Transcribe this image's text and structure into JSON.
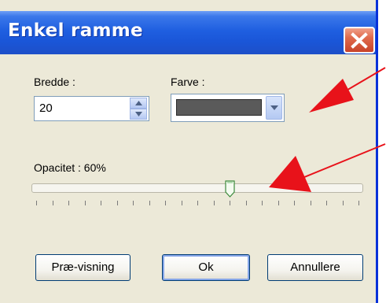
{
  "dialog": {
    "title": "Enkel ramme",
    "close_icon": "close-icon"
  },
  "width_field": {
    "label": "Bredde :",
    "value": "20",
    "up_icon": "spin-up-icon",
    "down_icon": "spin-down-icon"
  },
  "color_field": {
    "label": "Farve :",
    "swatch_color": "#5a5a5a",
    "dropdown_icon": "chevron-down-icon"
  },
  "opacity": {
    "label": "Opacitet : 60%",
    "level_fraction": 0.6,
    "tick_count": 21
  },
  "buttons": {
    "preview": "Præ-visning",
    "ok": "Ok",
    "cancel": "Annullere"
  },
  "annotation": {
    "arrow_color": "#e8121a"
  },
  "colors": {
    "titlebar": "#1f5fe0",
    "dialog_bg": "#ece9d8",
    "border": "#0831d9"
  }
}
